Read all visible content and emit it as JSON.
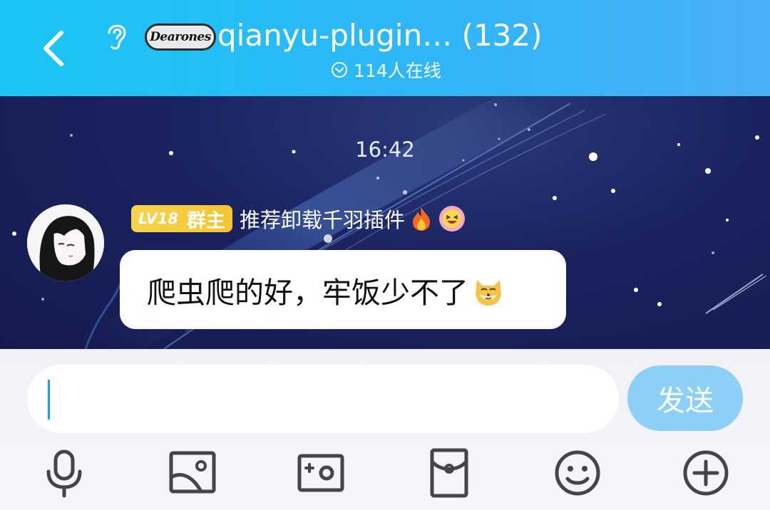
{
  "header": {
    "title": "qianyu-plugin… (132)",
    "logo_text": "Dearones",
    "online_text": "114人在线",
    "icons": {
      "back": "chevron-left-icon",
      "ear": "ear-icon",
      "online": "circle-chevron-down-icon"
    },
    "background_colors": [
      "#19c6f5",
      "#49b0f7"
    ]
  },
  "chat": {
    "timestamp": "16:42",
    "message": {
      "level_badge": "LV18",
      "role_badge": "群主",
      "sender_name": "推荐卸载千羽插件",
      "sender_icons": [
        "fire-emoji-icon",
        "grinning-flower-emoji-icon"
      ],
      "text": "爬虫爬的好，牢饭少不了",
      "trailing_emoji": "shiba-dog-emoji-icon"
    }
  },
  "composer": {
    "input_value": "",
    "send_label": "发送",
    "send_color": "#8cd0f7",
    "toolbar": [
      {
        "name": "microphone-icon"
      },
      {
        "name": "image-icon"
      },
      {
        "name": "camera-icon"
      },
      {
        "name": "red-packet-icon"
      },
      {
        "name": "emoji-smile-icon"
      },
      {
        "name": "plus-circle-icon"
      }
    ]
  }
}
